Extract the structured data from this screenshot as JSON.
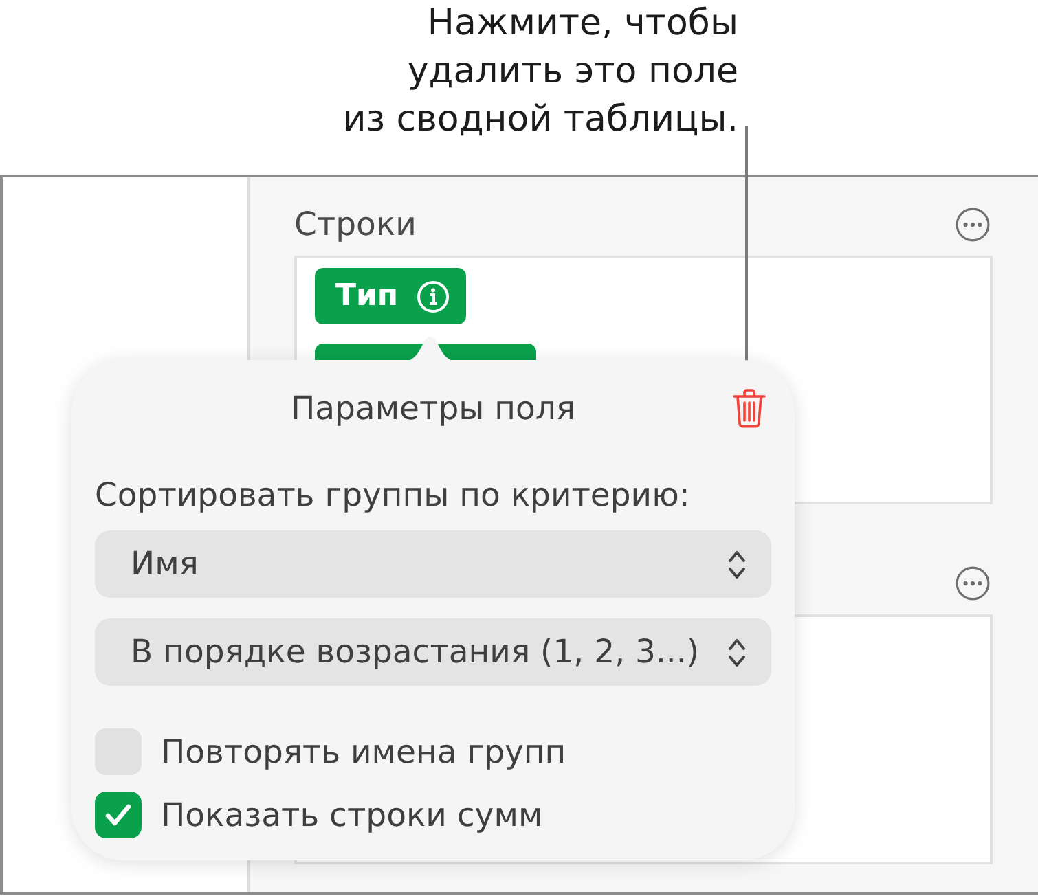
{
  "callout": {
    "lines": [
      "Нажмите, чтобы",
      "удалить это поле",
      "из сводной таблицы."
    ]
  },
  "panel": {
    "sections": [
      {
        "kind": "titled",
        "title": "Строки",
        "fields": [
          {
            "kind": "labeled",
            "label": "Тип"
          },
          {
            "kind": "covered"
          }
        ]
      },
      {
        "kind": "covered"
      }
    ]
  },
  "field_options": {
    "title": "Параметры поля",
    "sort_label": "Сортировать группы по критерию:",
    "selects": [
      {
        "value": "Имя"
      },
      {
        "value": "В порядке возрастания (1, 2, 3...)"
      }
    ],
    "checkboxes": [
      {
        "label": "Повторять имена групп",
        "checked": false
      },
      {
        "label": "Показать строки сумм",
        "checked": true
      }
    ]
  }
}
